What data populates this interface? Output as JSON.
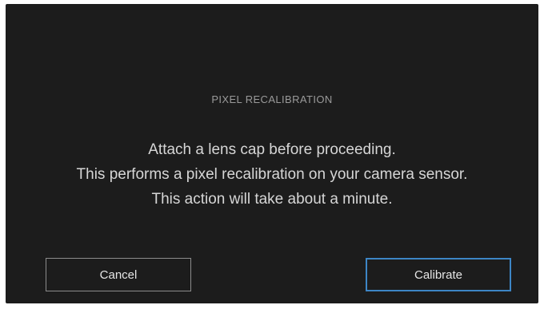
{
  "dialog": {
    "title": "PIXEL RECALIBRATION",
    "message_lines": [
      "Attach a lens cap before proceeding.",
      "This performs a pixel recalibration on your camera sensor.",
      "This action will take about a minute."
    ],
    "cancel_label": "Cancel",
    "calibrate_label": "Calibrate"
  },
  "colors": {
    "dialog_background": "#1c1c1c",
    "title_text": "#9a9a9a",
    "message_text": "#d6d6d6",
    "cancel_border": "#8c8c8c",
    "calibrate_border_accent": "#3d86c6"
  }
}
